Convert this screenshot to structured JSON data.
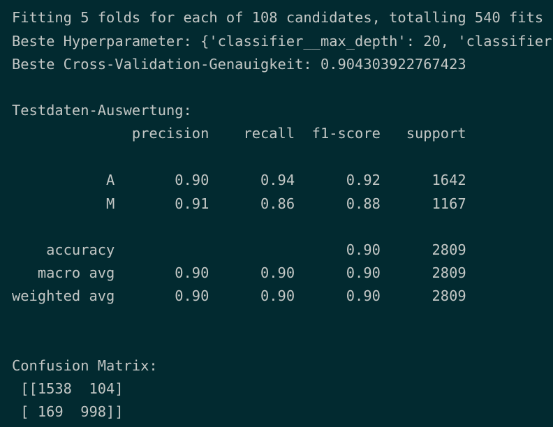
{
  "terminal": {
    "background": "#022a30",
    "text_color": "#c3c7c5",
    "lines": [
      "Fitting 5 folds for each of 108 candidates, totalling 540 fits",
      "Beste Hyperparameter: {'classifier__max_depth': 20, 'classifier",
      "Beste Cross-Validation-Genauigkeit: 0.904303922767423",
      "Testdaten-Auswertung:",
      "              precision    recall  f1-score   support",
      "           A       0.90      0.94      0.92      1642",
      "           M       0.91      0.86      0.88      1167",
      "    accuracy                           0.90      2809",
      "   macro avg       0.90      0.90      0.90      2809",
      "weighted avg       0.90      0.90      0.90      2809",
      "Confusion Matrix:",
      " [[1538  104]",
      " [ 169  998]]"
    ]
  }
}
